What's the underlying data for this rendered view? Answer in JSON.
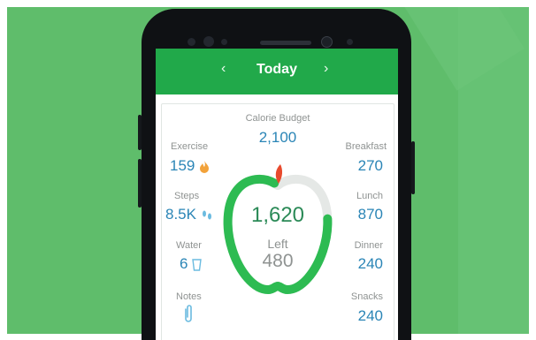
{
  "header": {
    "title": "Today",
    "prev_arrow": "‹",
    "next_arrow": "›"
  },
  "budget": {
    "label": "Calorie Budget",
    "value": "2,100"
  },
  "left_col": {
    "exercise": {
      "label": "Exercise",
      "value": "159",
      "icon": "flame-icon"
    },
    "steps": {
      "label": "Steps",
      "value": "8.5K",
      "icon": "footsteps-icon"
    },
    "water": {
      "label": "Water",
      "value": "6",
      "icon": "cup-icon"
    },
    "notes": {
      "label": "Notes",
      "icon": "paperclip-icon"
    }
  },
  "right_col": {
    "breakfast": {
      "label": "Breakfast",
      "value": "270"
    },
    "lunch": {
      "label": "Lunch",
      "value": "870"
    },
    "dinner": {
      "label": "Dinner",
      "value": "240"
    },
    "snacks": {
      "label": "Snacks",
      "value": "240"
    }
  },
  "apple": {
    "consumed": "1,620",
    "left_label": "Left",
    "left_value": "480",
    "progress_fraction": 0.77
  },
  "colors": {
    "header_green": "#21a94a",
    "background_green": "#5fbd6b",
    "value_blue": "#2a85b6",
    "ring_green": "#2dbb52",
    "stem_red": "#e84a2d"
  }
}
